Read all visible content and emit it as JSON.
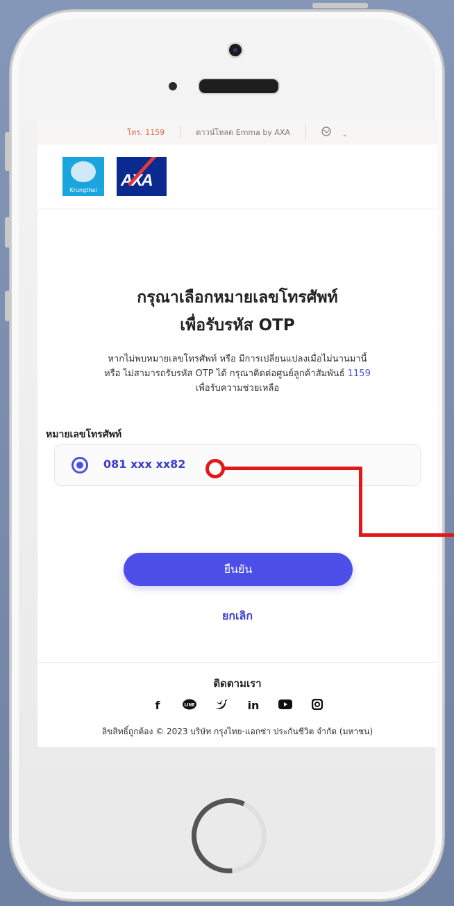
{
  "topbar": {
    "hotline": "โทร. 1159",
    "download": "ดาวน์โหลด Emma by AXA",
    "globe_icon": "globe-icon",
    "chevron_icon": "chevron-down-icon"
  },
  "logos": {
    "krungthai_label": "Krungthai",
    "axa_label": "AXA"
  },
  "main": {
    "title_line1": "กรุณาเลือกหมายเลขโทรศัพท์",
    "title_line2": "เพื่อรับรหัส OTP",
    "desc_line1": "หากไม่พบหมายเลขโทรศัพท์ หรือ มีการเปลี่ยนแปลงเมื่อไม่นานมานี้",
    "desc_line2_prefix": "หรือ ไม่สามารถรับรหัส OTP ได้ กรุณาติดต่อศูนย์ลูกค้าสัมพันธ์ ",
    "desc_link": "1159",
    "desc_line3": "เพื่อรับความช่วยเหลือ",
    "field_label": "หมายเลขโทรศัพท์",
    "phone_option": "081 xxx xx82",
    "confirm_button": "ยืนยัน",
    "cancel_link": "ยกเลิก"
  },
  "footer": {
    "follow_label": "ติดตามเรา",
    "social": [
      {
        "name": "facebook-icon",
        "glyph": "f"
      },
      {
        "name": "line-icon",
        "glyph": "LINE"
      },
      {
        "name": "twitter-icon",
        "glyph": "🐦"
      },
      {
        "name": "linkedin-icon",
        "glyph": "in"
      },
      {
        "name": "youtube-icon",
        "glyph": "▶"
      },
      {
        "name": "instagram-icon",
        "glyph": "◎"
      }
    ],
    "copyright": "ลิขสิทธิ์ถูกต้อง © 2023 บริษัท กรุงไทย-แอกซ่า ประกันชีวิต จำกัด (มหาชน)"
  },
  "colors": {
    "primary": "#4b4fe8",
    "annotation": "#e21818",
    "hotline": "#e06b4a"
  }
}
